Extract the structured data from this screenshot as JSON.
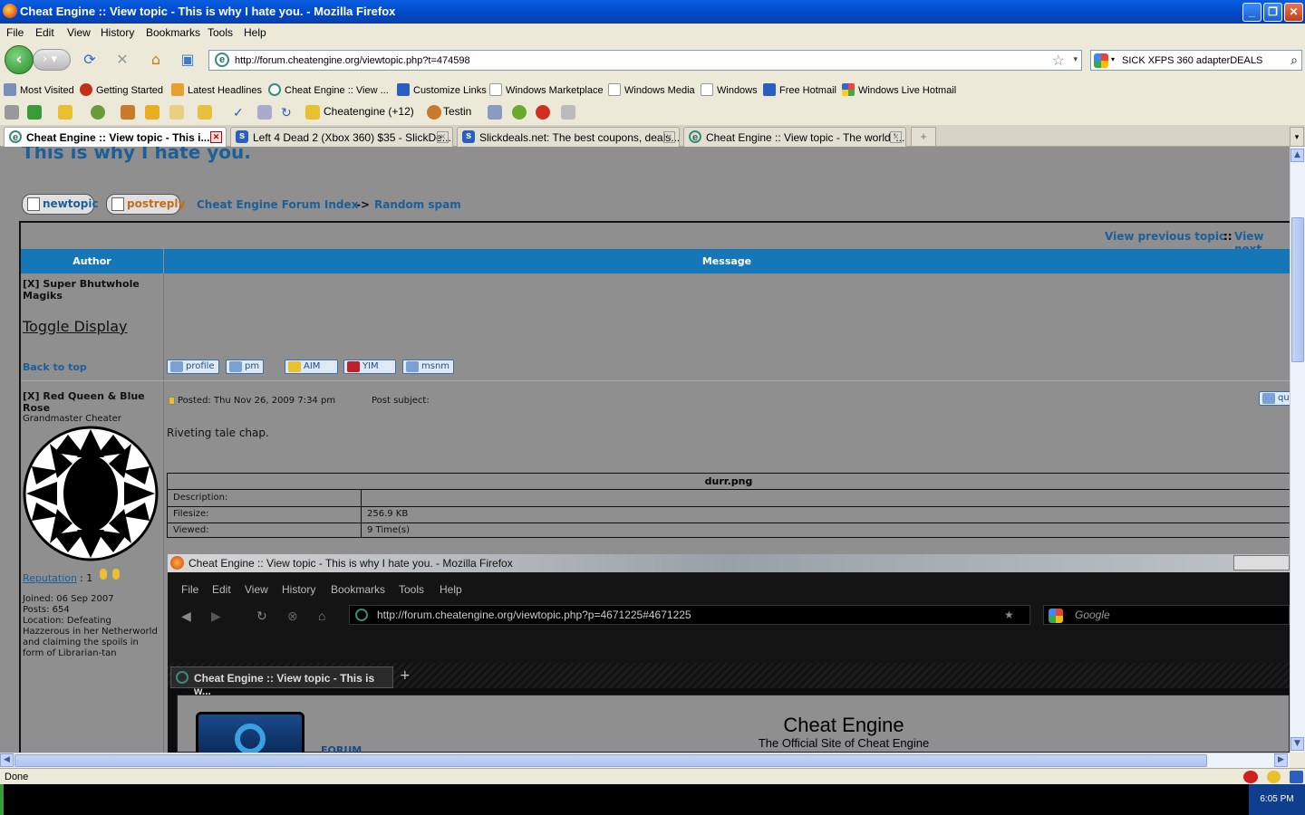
{
  "window": {
    "title": "Cheat Engine :: View topic - This is why I hate you. - Mozilla Firefox"
  },
  "menu": [
    "File",
    "Edit",
    "View",
    "History",
    "Bookmarks",
    "Tools",
    "Help"
  ],
  "nav": {
    "url": "http://forum.cheatengine.org/viewtopic.php?t=474598",
    "search_value": "SICK XFPS 360 adapterDEALS"
  },
  "bookmarks": [
    "Most Visited",
    "Getting Started",
    "Latest Headlines",
    "Cheat Engine :: View ...",
    "Customize Links",
    "Windows Marketplace",
    "Windows Media",
    "Windows",
    "Free Hotmail",
    "Windows Live Hotmail"
  ],
  "toolbar2": {
    "cheatengine": "Cheatengine (+12)",
    "testin": "Testin"
  },
  "tabs": [
    {
      "label": "Cheat Engine :: View topic - This i...",
      "active": true
    },
    {
      "label": "Left 4 Dead 2 (Xbox 360) $35 - SlickDe...",
      "active": false
    },
    {
      "label": "Slickdeals.net: The best coupons, deals...",
      "active": false
    },
    {
      "label": "Cheat Engine :: View topic - The world '...",
      "active": false
    }
  ],
  "page": {
    "topic_title": "This is why I hate you.",
    "new_topic": "newtopic",
    "post_reply": "postreply",
    "breadcrumb": {
      "index": "Cheat Engine Forum Index",
      "arrow": "->",
      "forum": "Random spam"
    },
    "topic_nav": {
      "prev": "View previous topic",
      "sep": "::",
      "next": "View next"
    },
    "headers": {
      "author": "Author",
      "message": "Message"
    },
    "post1": {
      "author": "[X] Super Bhutwhole Magiks",
      "toggle": "Toggle Display",
      "back_to_top": "Back to top",
      "buttons": [
        "profile",
        "pm",
        "AIM",
        "YIM",
        "msnm"
      ]
    },
    "post2": {
      "author": "[X] Red Queen & Blue Rose",
      "rank": "Grandmaster Cheater",
      "reputation_label": "Reputation",
      "reputation_value": ": 1",
      "joined": "Joined: 06 Sep 2007",
      "posts": "Posts: 654",
      "location": "Location: Defeating Hazzerous in her Netherworld and claiming the spoils in form of Librarian-tan",
      "posted": "Posted: Thu Nov 26, 2009 7:34 pm",
      "subject": "Post subject:",
      "quote": "qu",
      "body": "Riveting tale chap.",
      "attachment": {
        "name": "durr.png",
        "description_label": "Description:",
        "filesize_label": "Filesize:",
        "filesize": "256.9 KB",
        "viewed_label": "Viewed:",
        "viewed": "9 Time(s)"
      }
    },
    "embedded": {
      "title": "Cheat Engine :: View topic - This is why I hate you. - Mozilla Firefox",
      "menu": [
        "File",
        "Edit",
        "View",
        "History",
        "Bookmarks",
        "Tools",
        "Help"
      ],
      "url": "http://forum.cheatengine.org/viewtopic.php?p=4671225#4671225",
      "search_placeholder": "Google",
      "tab": "Cheat Engine :: View topic - This is w...",
      "site_title": "Cheat Engine",
      "site_subtitle": "The Official Site of Cheat Engine",
      "logo_text": "FORUM"
    }
  },
  "status": {
    "text": "Done"
  },
  "tray": {
    "time": "6:05 PM"
  }
}
